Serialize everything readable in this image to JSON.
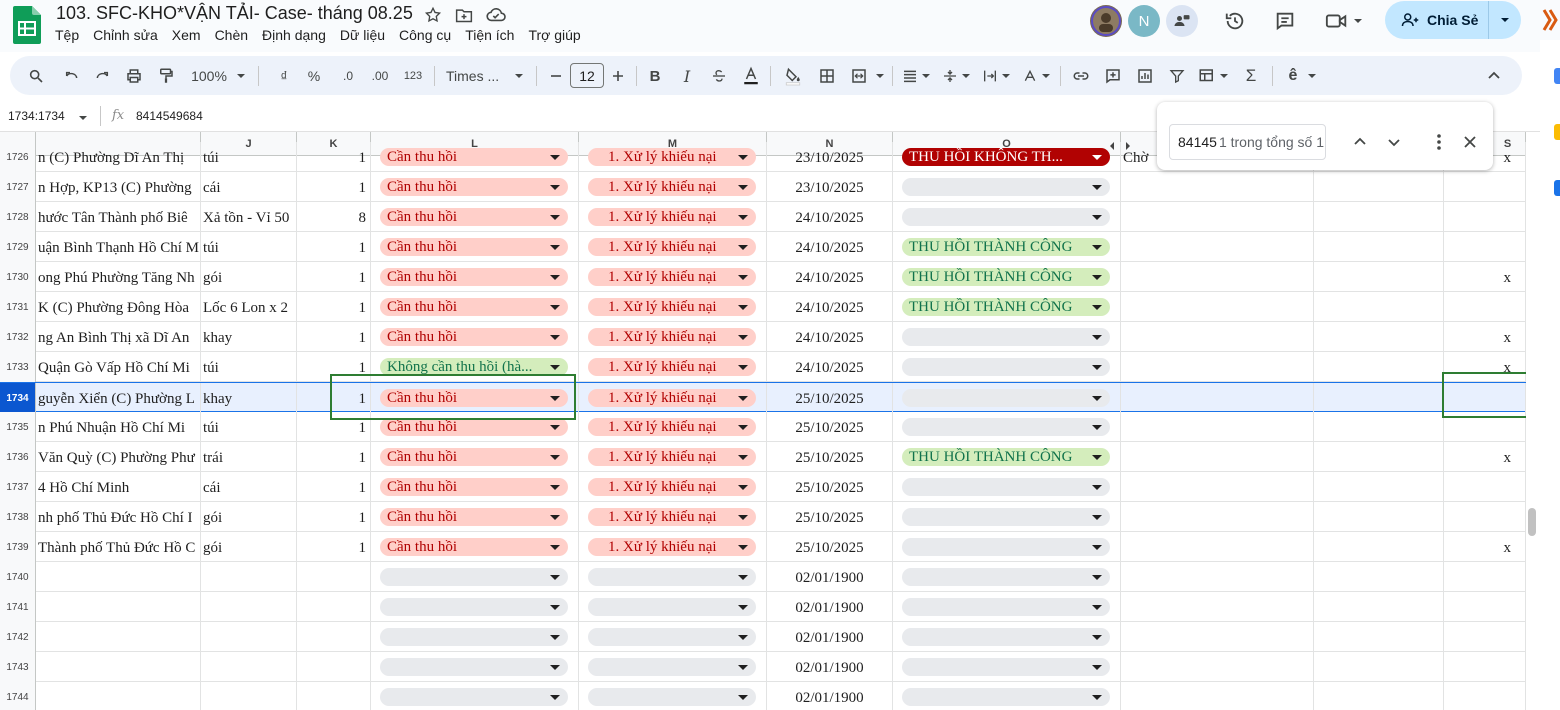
{
  "doc": {
    "title": "103. SFC-KHO*VẬN TẢI- Case- tháng 08.25",
    "menu": [
      "Tệp",
      "Chỉnh sửa",
      "Xem",
      "Chèn",
      "Định dạng",
      "Dữ liệu",
      "Công cụ",
      "Tiện ích",
      "Trợ giúp"
    ]
  },
  "header": {
    "avatar_letter": "N",
    "share_label": "Chia Sẻ"
  },
  "toolbar": {
    "zoom": "100%",
    "currency": "₫",
    "percent": "%",
    "dec_decrease": ".0",
    "dec_increase": ".00",
    "number_format": "123",
    "font": "Times ...",
    "font_size": "12"
  },
  "formula_bar": {
    "name_box": "1734:1734",
    "fx": "fx",
    "value": "8414549684"
  },
  "columns": [
    "J",
    "K",
    "L",
    "M",
    "N",
    "O",
    "",
    "",
    "S"
  ],
  "rows": [
    {
      "num": "1726",
      "i": "n (C) Phường Dĩ An Thị",
      "j": "túi",
      "k": "1",
      "l": "Cần thu hồi",
      "l_style": "red",
      "m": "1. Xử lý khiếu nại",
      "n": "23/10/2025",
      "o": "THU HỒI KHÔNG TH...",
      "o_style": "darkred",
      "p": "Chờ",
      "s": "x"
    },
    {
      "num": "1727",
      "i": "n Hợp, KP13 (C) Phường",
      "j": "cái",
      "k": "1",
      "l": "Cần thu hồi",
      "l_style": "red",
      "m": "1. Xử lý khiếu nại",
      "n": "23/10/2025",
      "o": "",
      "o_style": "empty",
      "p": "",
      "s": ""
    },
    {
      "num": "1728",
      "i": "hước Tân Thành phố Biê",
      "j": "Xả tồn - Vỉ 50",
      "k": "8",
      "l": "Cần thu hồi",
      "l_style": "red",
      "m": "1. Xử lý khiếu nại",
      "n": "24/10/2025",
      "o": "",
      "o_style": "empty",
      "p": "",
      "s": ""
    },
    {
      "num": "1729",
      "i": "uận Bình Thạnh Hồ Chí M",
      "j": "túi",
      "k": "1",
      "l": "Cần thu hồi",
      "l_style": "red",
      "m": "1. Xử lý khiếu nại",
      "n": "24/10/2025",
      "o": "THU HỒI THÀNH CÔNG",
      "o_style": "green",
      "p": "",
      "s": ""
    },
    {
      "num": "1730",
      "i": "ong Phú Phường Tăng Nh",
      "j": "gói",
      "k": "1",
      "l": "Cần thu hồi",
      "l_style": "red",
      "m": "1. Xử lý khiếu nại",
      "n": "24/10/2025",
      "o": "THU HỒI THÀNH CÔNG",
      "o_style": "green",
      "p": "",
      "s": "x"
    },
    {
      "num": "1731",
      "i": "K (C) Phường Đông Hòa",
      "j": "Lốc 6 Lon x 2",
      "k": "1",
      "l": "Cần thu hồi",
      "l_style": "red",
      "m": "1. Xử lý khiếu nại",
      "n": "24/10/2025",
      "o": "THU HỒI THÀNH CÔNG",
      "o_style": "green",
      "p": "",
      "s": ""
    },
    {
      "num": "1732",
      "i": "ng An Bình Thị xã Dĩ An",
      "j": "khay",
      "k": "1",
      "l": "Cần thu hồi",
      "l_style": "red",
      "m": "1. Xử lý khiếu nại",
      "n": "24/10/2025",
      "o": "",
      "o_style": "empty",
      "p": "",
      "s": "x"
    },
    {
      "num": "1733",
      "i": "Quận Gò Vấp Hồ Chí Mi",
      "j": "túi",
      "k": "1",
      "l": "Không cần thu hồi (hà...",
      "l_style": "green",
      "m": "1. Xử lý khiếu nại",
      "n": "24/10/2025",
      "o": "",
      "o_style": "empty",
      "p": "",
      "s": "x"
    },
    {
      "num": "1734",
      "i": "guyễn Xiển (C) Phường L",
      "j": "khay",
      "k": "1",
      "l": "Cần thu hồi",
      "l_style": "red",
      "m": "1. Xử lý khiếu nại",
      "n": "25/10/2025",
      "o": "",
      "o_style": "empty",
      "p": "",
      "s": "",
      "selected": true
    },
    {
      "num": "1735",
      "i": "n Phú Nhuận Hồ Chí Mi",
      "j": "túi",
      "k": "1",
      "l": "Cần thu hồi",
      "l_style": "red",
      "m": "1. Xử lý khiếu nại",
      "n": "25/10/2025",
      "o": "",
      "o_style": "empty",
      "p": "",
      "s": ""
    },
    {
      "num": "1736",
      "i": "Văn Quỳ (C) Phường Phư",
      "j": "trái",
      "k": "1",
      "l": "Cần thu hồi",
      "l_style": "red",
      "m": "1. Xử lý khiếu nại",
      "n": "25/10/2025",
      "o": "THU HỒI THÀNH CÔNG",
      "o_style": "green",
      "p": "",
      "s": "x"
    },
    {
      "num": "1737",
      "i": "4 Hồ Chí Minh",
      "j": "cái",
      "k": "1",
      "l": "Cần thu hồi",
      "l_style": "red",
      "m": "1. Xử lý khiếu nại",
      "n": "25/10/2025",
      "o": "",
      "o_style": "empty",
      "p": "",
      "s": ""
    },
    {
      "num": "1738",
      "i": "nh phố Thủ Đức Hồ Chí I",
      "j": "gói",
      "k": "1",
      "l": "Cần thu hồi",
      "l_style": "red",
      "m": "1. Xử lý khiếu nại",
      "n": "25/10/2025",
      "o": "",
      "o_style": "empty",
      "p": "",
      "s": ""
    },
    {
      "num": "1739",
      "i": "Thành phố Thủ Đức Hồ C",
      "j": "gói",
      "k": "1",
      "l": "Cần thu hồi",
      "l_style": "red",
      "m": "1. Xử lý khiếu nại",
      "n": "25/10/2025",
      "o": "",
      "o_style": "empty",
      "p": "",
      "s": "x"
    },
    {
      "num": "1740",
      "i": "",
      "j": "",
      "k": "",
      "l": "",
      "l_style": "empty",
      "m": "",
      "n": "02/01/1900",
      "o": "",
      "o_style": "empty",
      "p": "",
      "s": ""
    },
    {
      "num": "1741",
      "i": "",
      "j": "",
      "k": "",
      "l": "",
      "l_style": "empty",
      "m": "",
      "n": "02/01/1900",
      "o": "",
      "o_style": "empty",
      "p": "",
      "s": ""
    },
    {
      "num": "1742",
      "i": "",
      "j": "",
      "k": "",
      "l": "",
      "l_style": "empty",
      "m": "",
      "n": "02/01/1900",
      "o": "",
      "o_style": "empty",
      "p": "",
      "s": ""
    },
    {
      "num": "1743",
      "i": "",
      "j": "",
      "k": "",
      "l": "",
      "l_style": "empty",
      "m": "",
      "n": "02/01/1900",
      "o": "",
      "o_style": "empty",
      "p": "",
      "s": ""
    },
    {
      "num": "1744",
      "i": "",
      "j": "",
      "k": "",
      "l": "",
      "l_style": "empty",
      "m": "",
      "n": "02/01/1900",
      "o": "",
      "o_style": "empty",
      "p": "",
      "s": ""
    }
  ],
  "find": {
    "query": "84145",
    "count": "1 trong tổng số 1"
  },
  "colors": {
    "chip_red_bg": "#ffcfc9",
    "chip_green_bg": "#d4edbc",
    "chip_darkred_bg": "#b10202",
    "selection_border": "#2e7d32",
    "share_bg": "#c2e7ff"
  }
}
